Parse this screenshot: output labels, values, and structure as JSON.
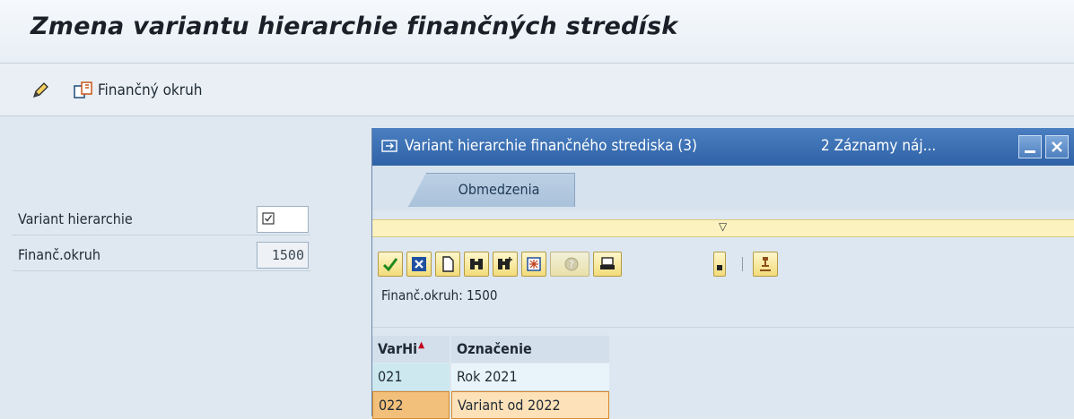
{
  "window": {
    "title": "Zmena variantu hierarchie finančných stredísk"
  },
  "toolbar": {
    "edit_icon": "pencil-icon",
    "area_icon": "copy-area-icon",
    "area_label": "Finančný okruh"
  },
  "form": {
    "fields": [
      {
        "label": "Variant hierarchie",
        "value": "",
        "icon": "f4-help-icon"
      },
      {
        "label": "Finanč.okruh",
        "value": "1500"
      }
    ]
  },
  "dialog": {
    "title": "Variant hierarchie finančného strediska (3)",
    "count": "2 Záznamy náj...",
    "tab": "Obmedzenia",
    "filter": "Finanč.okruh: 1500",
    "columns": [
      "VarHi",
      "Označenie"
    ],
    "rows": [
      {
        "key": "021",
        "text": "Rok 2021"
      },
      {
        "key": "022",
        "text": "Variant od 2022"
      }
    ],
    "buttons": [
      "check-icon",
      "cancel-icon",
      "new-icon",
      "find-icon",
      "find-next-icon",
      "select-icon",
      "help-icon",
      "print-icon",
      "pin-icon"
    ]
  },
  "colors": {
    "title_bar": "#3468ad",
    "selection": "#f2c07a",
    "toolbar_button": "#f2dc7a"
  }
}
